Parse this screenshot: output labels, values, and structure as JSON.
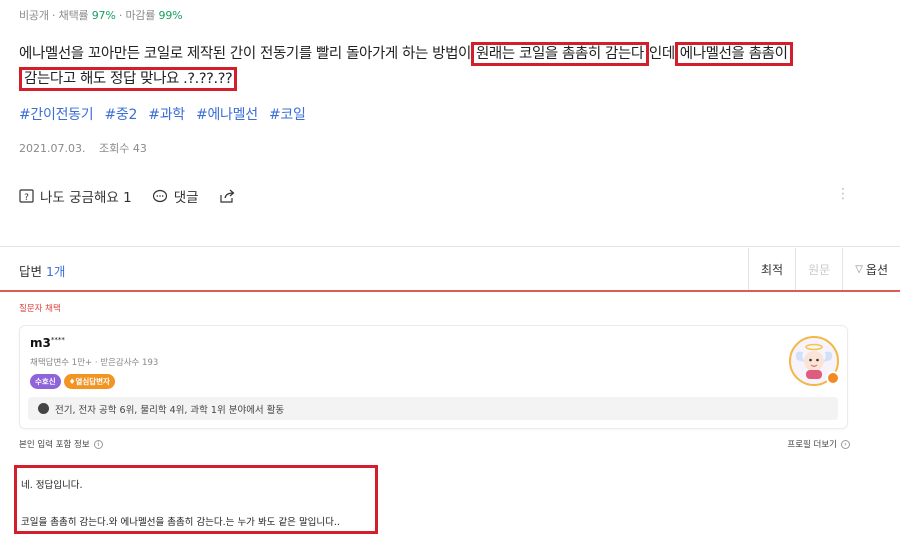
{
  "meta": {
    "prefix": "비공개 · 채택률 ",
    "adopt_rate": "97%",
    "mid": " · 마감률 ",
    "close_rate": "99%"
  },
  "question": {
    "part1": "에나멜선을 꼬아만든 코일로 제작된 간이 전동기를 빨리 돌아가게 하는 방법이",
    "hl1": "원래는 코일을 촘촘히 감는다",
    "part2": "인데",
    "hl2_line1": "에나멜선을 촘촘이",
    "hl2_line2": "감는다고 해도 정답 맞나요 .?.??.??"
  },
  "tags": [
    "#간이전동기",
    "#중2",
    "#과학",
    "#에나멜선",
    "#코일"
  ],
  "date": "2021.07.03.",
  "views": "조회수 43",
  "actions": {
    "curious": "나도 궁금해요 1",
    "comment": "댓글",
    "more": "⋮"
  },
  "answers_header": {
    "label": "답변 ",
    "count": "1개"
  },
  "sort": {
    "latest": "최적",
    "original": "원문",
    "options": "옵션"
  },
  "chosen_label": "질문자 채택",
  "answerer": {
    "name": "m3",
    "mask": "****",
    "stats": "채택답변수 1만+ · 받은감사수 193",
    "badge1": "수호신",
    "badge2": "열심답변자",
    "expertise": "전기, 전자 공학 6위, 물리학 4위, 과학 1위 분야에서 활동"
  },
  "self_info": "본인 입력 포함 정보",
  "profile_more": "프로필 더보기",
  "answer_text": {
    "line1": "네. 정답입니다.",
    "line2": "코일을 촘촘히 감는다.와 에나멜선을 촘촘히 감는다.는 누가 봐도 같은 말입니다.."
  },
  "colors": {
    "accent_blue": "#3b6fd6",
    "highlight_red": "#d21f2b",
    "stat_green": "#17a05d"
  }
}
